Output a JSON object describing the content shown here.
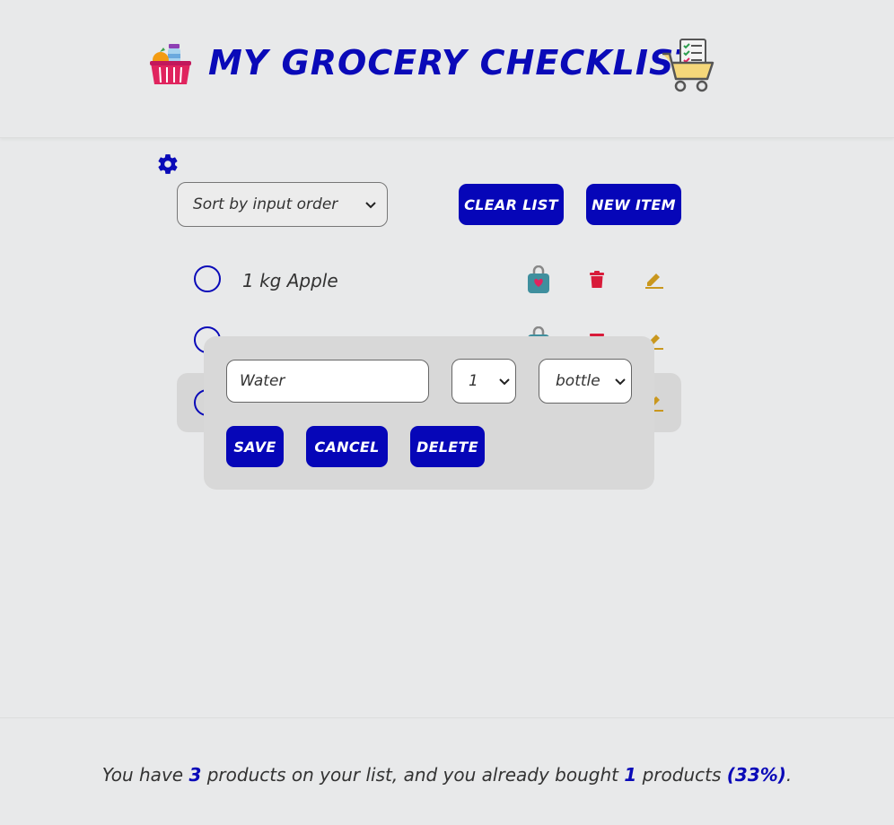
{
  "header": {
    "title": "MY GROCERY CHECKLIST"
  },
  "toolbar": {
    "sort_value": "Sort by input order",
    "clear_label": "CLEAR LIST",
    "new_label": "NEW ITEM"
  },
  "items": [
    {
      "label": "1 kg Apple",
      "bought": false
    },
    {
      "label": "",
      "bought": false
    },
    {
      "label": "",
      "bought": true
    }
  ],
  "edit_modal": {
    "name_value": "Water",
    "quantity_value": "1",
    "unit_value": "bottle",
    "save_label": "SAVE",
    "cancel_label": "CANCEL",
    "delete_label": "DELETE"
  },
  "summary": {
    "prefix": "You have",
    "total": "3",
    "middle": "products on your list, and you already bought",
    "bought": "1",
    "suffix": "products",
    "percent": "(33%)",
    "end": "."
  },
  "colors": {
    "accent": "#0606b8",
    "delete": "#d81b3a",
    "edit": "#c9971e"
  },
  "icons": [
    "basket-icon",
    "cart-checklist-icon",
    "gear-icon",
    "bag-icon",
    "trash-icon",
    "pencil-icon",
    "chevron-down-icon"
  ]
}
